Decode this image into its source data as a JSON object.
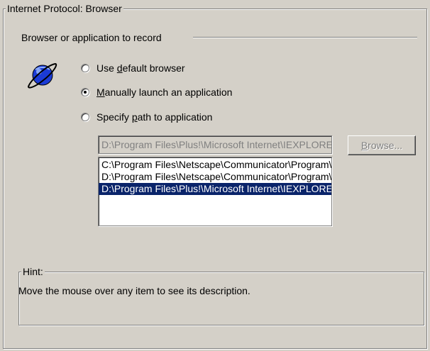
{
  "group": {
    "title": "Internet Protocol: Browser"
  },
  "section": {
    "label": "Browser or application to record"
  },
  "options": [
    {
      "pre": "Use ",
      "accel": "d",
      "post": "efault browser",
      "checked": false
    },
    {
      "pre": "",
      "accel": "M",
      "post": "anually launch an application",
      "checked": true
    },
    {
      "pre": "Specify ",
      "accel": "p",
      "post": "ath to application",
      "checked": false
    }
  ],
  "path_input": {
    "value": "D:\\Program Files\\Plus!\\Microsoft Internet\\IEXPLORE.EXE"
  },
  "browse_button": {
    "accel": "B",
    "rest": "rowse..."
  },
  "list": {
    "items": [
      "C:\\Program Files\\Netscape\\Communicator\\Program\\netscape.exe",
      "D:\\Program Files\\Netscape\\Communicator\\Program\\netscape.exe",
      "D:\\Program Files\\Plus!\\Microsoft Internet\\IEXPLORE.EXE"
    ],
    "selected_index": 2
  },
  "hint": {
    "title": "Hint:",
    "text": "Move the mouse over any item to see its description."
  },
  "colors": {
    "background": "#d4d0c8",
    "selection": "#0a246a",
    "globe": "#1b3bd6"
  },
  "icon": "internet-explorer-globe-icon"
}
